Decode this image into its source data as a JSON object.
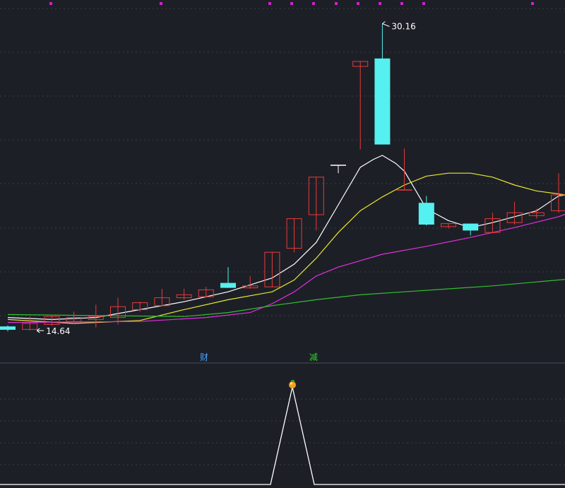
{
  "chart_data": {
    "type": "candlestick",
    "price_range": [
      13.5,
      31.0
    ],
    "annotations": {
      "high_label": "30.16",
      "low_label": "14.64",
      "marker_cai": "财",
      "marker_jian": "减"
    },
    "candles": [
      {
        "o": 14.68,
        "c": 14.85,
        "h": 14.9,
        "l": 14.6,
        "dir": "down"
      },
      {
        "o": 14.7,
        "c": 15.0,
        "h": 15.35,
        "l": 14.64,
        "dir": "up"
      },
      {
        "o": 14.95,
        "c": 15.35,
        "h": 15.45,
        "l": 14.9,
        "dir": "up"
      },
      {
        "o": 15.1,
        "c": 15.3,
        "h": 15.6,
        "l": 15.0,
        "dir": "up"
      },
      {
        "o": 15.2,
        "c": 15.35,
        "h": 15.95,
        "l": 14.8,
        "dir": "up"
      },
      {
        "o": 15.3,
        "c": 15.85,
        "h": 16.3,
        "l": 14.95,
        "dir": "up"
      },
      {
        "o": 15.7,
        "c": 16.05,
        "h": 16.1,
        "l": 15.6,
        "dir": "up"
      },
      {
        "o": 15.9,
        "c": 16.3,
        "h": 16.75,
        "l": 15.9,
        "dir": "up"
      },
      {
        "o": 16.3,
        "c": 16.45,
        "h": 16.75,
        "l": 16.2,
        "dir": "up"
      },
      {
        "o": 16.35,
        "c": 16.7,
        "h": 16.85,
        "l": 16.3,
        "dir": "up"
      },
      {
        "o": 17.05,
        "c": 16.8,
        "h": 17.85,
        "l": 16.8,
        "dir": "down"
      },
      {
        "o": 16.8,
        "c": 16.9,
        "h": 17.4,
        "l": 16.75,
        "dir": "up"
      },
      {
        "o": 16.85,
        "c": 18.6,
        "h": 18.6,
        "l": 16.85,
        "dir": "up"
      },
      {
        "o": 18.8,
        "c": 20.3,
        "h": 20.3,
        "l": 18.6,
        "dir": "up"
      },
      {
        "o": 20.5,
        "c": 22.4,
        "h": 22.4,
        "l": 19.7,
        "dir": "up"
      },
      {
        "o": 23.0,
        "c": 23.0,
        "h": 23.0,
        "l": 22.6,
        "dir": "doji"
      },
      {
        "o": 28.0,
        "c": 28.25,
        "h": 28.25,
        "l": 23.8,
        "dir": "up"
      },
      {
        "o": 28.4,
        "c": 24.05,
        "h": 30.16,
        "l": 24.05,
        "dir": "down"
      },
      {
        "o": 21.75,
        "c": 21.75,
        "h": 23.85,
        "l": 21.75,
        "dir": "doji"
      },
      {
        "o": 21.1,
        "c": 20.0,
        "h": 21.45,
        "l": 19.95,
        "dir": "down"
      },
      {
        "o": 19.9,
        "c": 20.05,
        "h": 20.05,
        "l": 19.8,
        "dir": "up"
      },
      {
        "o": 20.05,
        "c": 19.7,
        "h": 20.05,
        "l": 19.45,
        "dir": "down"
      },
      {
        "o": 19.6,
        "c": 20.3,
        "h": 20.6,
        "l": 19.55,
        "dir": "up"
      },
      {
        "o": 20.1,
        "c": 20.6,
        "h": 21.15,
        "l": 20.0,
        "dir": "up"
      },
      {
        "o": 20.45,
        "c": 20.6,
        "h": 20.8,
        "l": 20.3,
        "dir": "up"
      },
      {
        "o": 20.7,
        "c": 21.5,
        "h": 22.6,
        "l": 20.6,
        "dir": "up"
      },
      {
        "o": 22.0,
        "c": 23.25,
        "h": 24.0,
        "l": 21.6,
        "dir": "up"
      }
    ],
    "series": [
      {
        "color": "#ffffff",
        "points": [
          [
            0,
            15.3
          ],
          [
            2,
            15.2
          ],
          [
            4,
            15.3
          ],
          [
            6,
            15.7
          ],
          [
            8,
            16.1
          ],
          [
            10,
            16.6
          ],
          [
            12,
            17.3
          ],
          [
            13,
            18.0
          ],
          [
            14,
            19.1
          ],
          [
            15,
            21.0
          ],
          [
            16,
            22.9
          ],
          [
            16.6,
            23.3
          ],
          [
            17,
            23.5
          ],
          [
            17.6,
            23.1
          ],
          [
            18,
            22.7
          ],
          [
            19,
            20.8
          ],
          [
            20,
            20.2
          ],
          [
            21,
            19.85
          ],
          [
            22,
            20.1
          ],
          [
            23,
            20.4
          ],
          [
            24,
            20.7
          ],
          [
            25,
            21.45
          ],
          [
            26,
            21.6
          ]
        ]
      },
      {
        "color": "#e8e830",
        "points": [
          [
            0,
            15.2
          ],
          [
            3,
            15.0
          ],
          [
            6,
            15.15
          ],
          [
            8,
            15.7
          ],
          [
            10,
            16.2
          ],
          [
            12,
            16.6
          ],
          [
            13,
            17.2
          ],
          [
            14,
            18.3
          ],
          [
            15,
            19.6
          ],
          [
            16,
            20.7
          ],
          [
            17,
            21.4
          ],
          [
            18,
            22.0
          ],
          [
            19,
            22.45
          ],
          [
            20,
            22.6
          ],
          [
            21,
            22.6
          ],
          [
            22,
            22.4
          ],
          [
            23,
            22.0
          ],
          [
            24,
            21.7
          ],
          [
            25,
            21.55
          ],
          [
            26,
            21.4
          ]
        ]
      },
      {
        "color": "#e030e0",
        "points": [
          [
            0,
            15.05
          ],
          [
            6,
            15.1
          ],
          [
            9,
            15.3
          ],
          [
            11,
            15.55
          ],
          [
            12,
            16.0
          ],
          [
            13,
            16.6
          ],
          [
            14,
            17.4
          ],
          [
            15,
            17.85
          ],
          [
            17,
            18.5
          ],
          [
            19,
            18.9
          ],
          [
            21,
            19.35
          ],
          [
            23,
            19.85
          ],
          [
            25,
            20.4
          ],
          [
            26,
            20.8
          ]
        ]
      },
      {
        "color": "#30c030",
        "points": [
          [
            0,
            15.45
          ],
          [
            4,
            15.4
          ],
          [
            8,
            15.35
          ],
          [
            10,
            15.55
          ],
          [
            12,
            15.9
          ],
          [
            14,
            16.2
          ],
          [
            16,
            16.45
          ],
          [
            18,
            16.6
          ],
          [
            20,
            16.75
          ],
          [
            22,
            16.9
          ],
          [
            24,
            17.1
          ],
          [
            26,
            17.3
          ]
        ]
      }
    ],
    "indicator": {
      "values": [
        0,
        0,
        0,
        0,
        0,
        0,
        0,
        0,
        0,
        0,
        0,
        0,
        1,
        0,
        0,
        0,
        0,
        0,
        0,
        0,
        0,
        0,
        0,
        0,
        0,
        0,
        0
      ],
      "color": "#ffffff"
    }
  }
}
